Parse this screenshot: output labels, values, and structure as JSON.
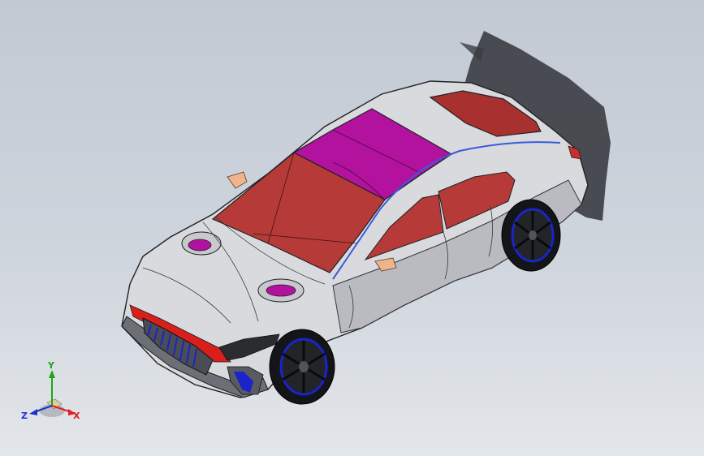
{
  "viewport": {
    "background_top": "#c2c9d3",
    "background_bottom": "#e3e6ea"
  },
  "model": {
    "body_color": "#d9dade",
    "glass_color": "#b63a37",
    "roof_color": "#b2129e",
    "accent_color": "#d81f1c",
    "wheel_accent": "#1a24c8",
    "mirror_color": "#f0b48c"
  },
  "triad": {
    "x_label": "X",
    "y_label": "Y",
    "z_label": "Z",
    "x_color": "#e02020",
    "y_color": "#18a818",
    "z_color": "#2030d0"
  }
}
